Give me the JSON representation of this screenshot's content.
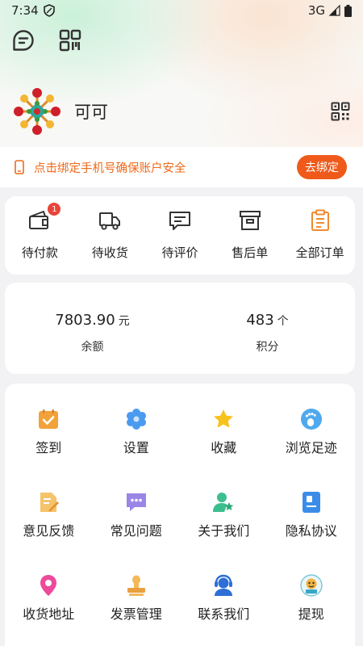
{
  "status_bar": {
    "time": "7:34",
    "network": "3G"
  },
  "user": {
    "name": "可可"
  },
  "bind_phone": {
    "text": "点击绑定手机号确保账户安全",
    "button_label": "去绑定"
  },
  "orders": [
    {
      "label": "待付款",
      "icon": "wallet-icon",
      "badge": "1"
    },
    {
      "label": "待收货",
      "icon": "truck-icon"
    },
    {
      "label": "待评价",
      "icon": "comment-icon"
    },
    {
      "label": "售后单",
      "icon": "archive-box-icon"
    },
    {
      "label": "全部订单",
      "icon": "clipboard-icon"
    }
  ],
  "wallet": {
    "balance": {
      "value": "7803.90",
      "unit": "元",
      "label": "余额"
    },
    "points": {
      "value": "483",
      "unit": "个",
      "label": "积分"
    }
  },
  "services": [
    {
      "label": "签到",
      "icon": "calendar-check-icon"
    },
    {
      "label": "设置",
      "icon": "gear-icon"
    },
    {
      "label": "收藏",
      "icon": "star-icon"
    },
    {
      "label": "浏览足迹",
      "icon": "footprint-icon"
    },
    {
      "label": "意见反馈",
      "icon": "feedback-icon"
    },
    {
      "label": "常见问题",
      "icon": "chat-bubble-icon"
    },
    {
      "label": "关于我们",
      "icon": "user-star-icon"
    },
    {
      "label": "隐私协议",
      "icon": "privacy-doc-icon"
    },
    {
      "label": "收货地址",
      "icon": "location-pin-icon"
    },
    {
      "label": "发票管理",
      "icon": "stamp-icon"
    },
    {
      "label": "联系我们",
      "icon": "headset-icon"
    },
    {
      "label": "提现",
      "icon": "withdraw-icon"
    }
  ],
  "colors": {
    "accent": "#ef5a1a",
    "badge": "#e8443a",
    "orange_icon": "#f08a30"
  }
}
